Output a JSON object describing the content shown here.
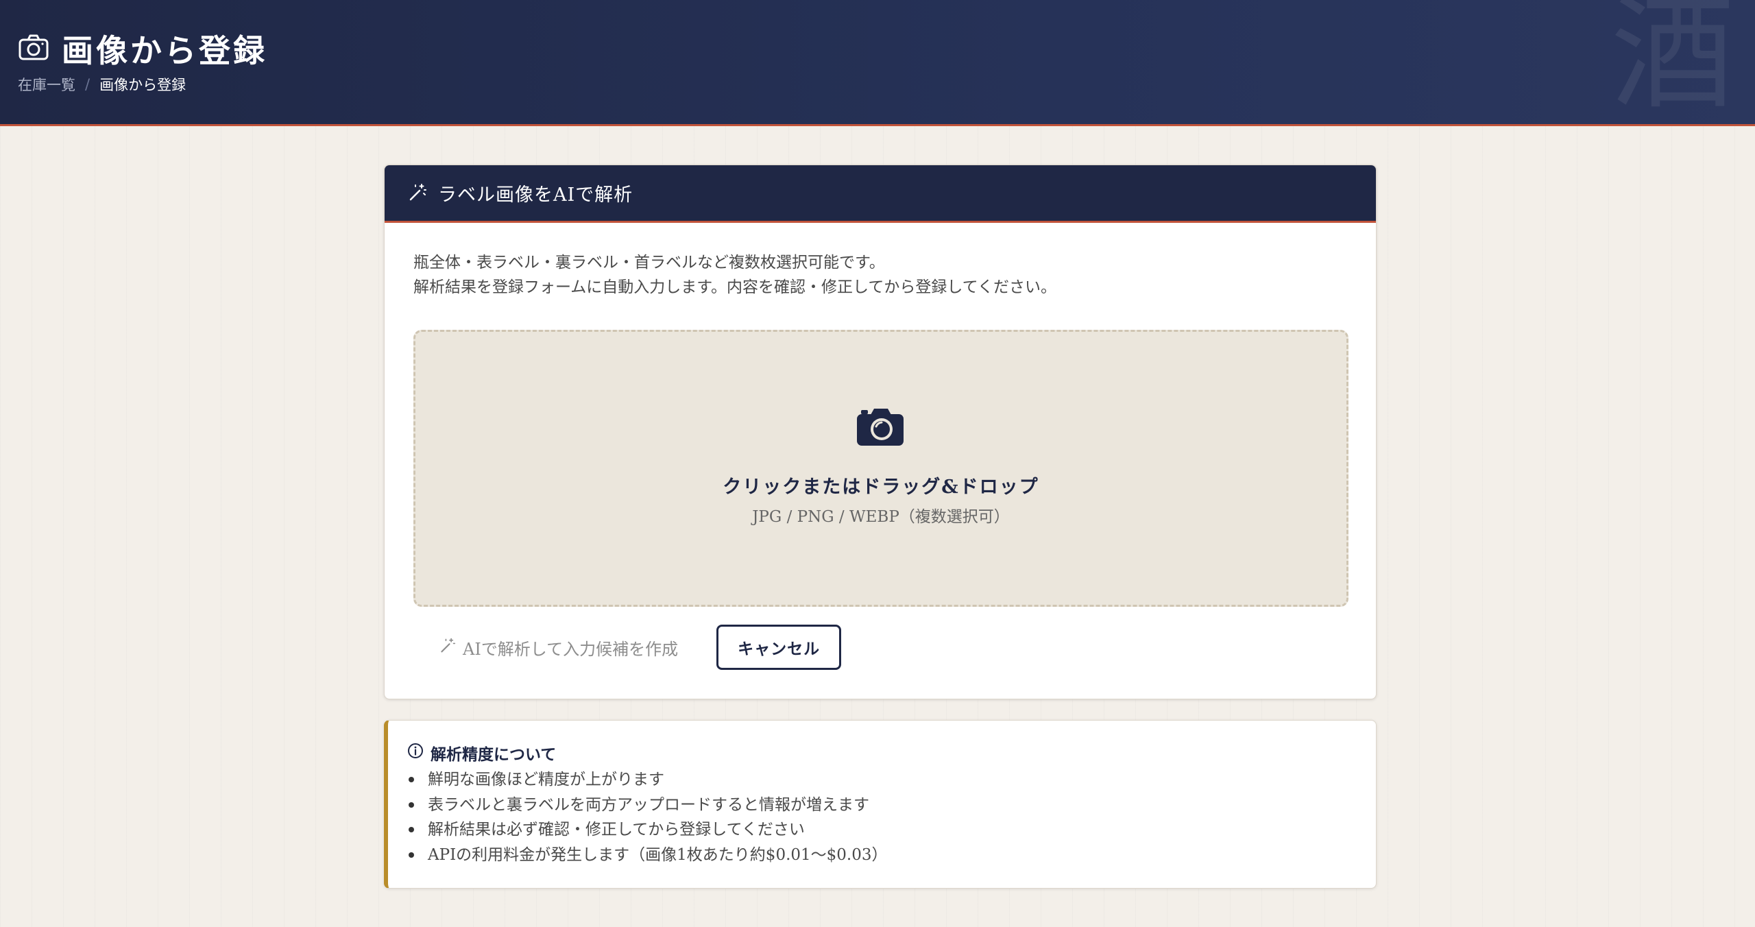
{
  "header": {
    "title": "画像から登録",
    "title_icon": "camera-outline-icon",
    "watermark": "酒",
    "breadcrumb": {
      "parent": "在庫一覧",
      "separator": "/",
      "current": "画像から登録"
    }
  },
  "card": {
    "title_icon": "magic-wand-icon",
    "title": "ラベル画像をAIで解析",
    "description": [
      "瓶全体・表ラベル・裏ラベル・首ラベルなど複数枚選択可能です。",
      "解析結果を登録フォームに自動入力します。内容を確認・修正してから登録してください。"
    ],
    "dropzone": {
      "icon": "camera-icon",
      "title": "クリックまたはドラッグ&ドロップ",
      "subtitle": "JPG / PNG / WEBP（複数選択可）"
    },
    "analyze_label": "AIで解析して入力候補を作成",
    "cancel_label": "キャンセル"
  },
  "note": {
    "icon": "info-icon",
    "title": "解析精度について",
    "items": [
      "鮮明な画像ほど精度が上がります",
      "表ラベルと裏ラベルを両方アップロードすると情報が増えます",
      "解析結果は必ず確認・修正してから登録してください",
      "APIの利用料金が発生します（画像1枚あたり約$0.01〜$0.03）"
    ]
  },
  "colors": {
    "navy": "#1f2745",
    "accent_red": "#c2543a",
    "gold": "#b98d2a",
    "background": "#f3efe9",
    "dropzone_bg": "#ebe6dc"
  }
}
